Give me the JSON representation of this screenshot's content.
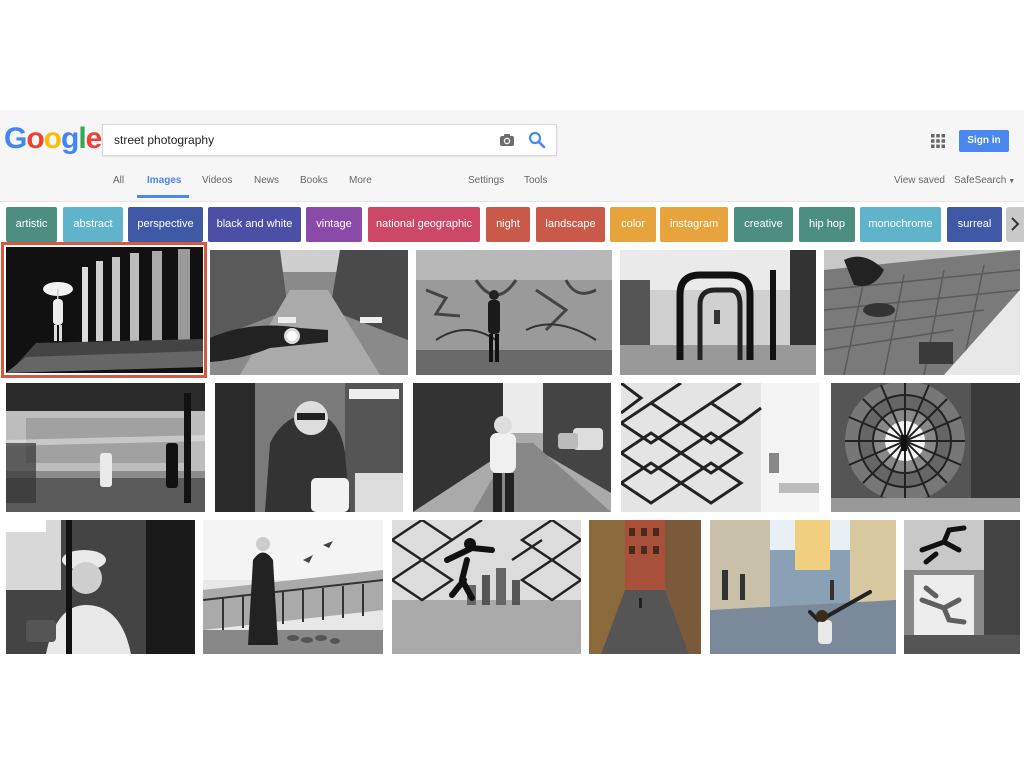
{
  "search": {
    "query": "street photography"
  },
  "logo": {
    "letters": [
      "G",
      "o",
      "o",
      "g",
      "l",
      "e"
    ],
    "colors": [
      "#4285f4",
      "#ea4335",
      "#fbbc05",
      "#4285f4",
      "#34a853",
      "#ea4335"
    ]
  },
  "header": {
    "sign_in_label": "Sign in"
  },
  "nav": {
    "all": "All",
    "images": "Images",
    "videos": "Videos",
    "news": "News",
    "books": "Books",
    "more": "More",
    "settings": "Settings",
    "tools": "Tools",
    "view_saved": "View saved",
    "safesearch": "SafeSearch"
  },
  "chips": [
    {
      "label": "artistic",
      "color": "#4c8e80"
    },
    {
      "label": "abstract",
      "color": "#5fb4cc"
    },
    {
      "label": "perspective",
      "color": "#3f59a6"
    },
    {
      "label": "black and white",
      "color": "#4b4fa6"
    },
    {
      "label": "vintage",
      "color": "#8a4aa8"
    },
    {
      "label": "national geographic",
      "color": "#cc4866"
    },
    {
      "label": "night",
      "color": "#c95a4a"
    },
    {
      "label": "landscape",
      "color": "#c95a4a"
    },
    {
      "label": "color",
      "color": "#e7a33c"
    },
    {
      "label": "instagram",
      "color": "#e7a33c"
    },
    {
      "label": "creative",
      "color": "#4c8e80"
    },
    {
      "label": "hip hop",
      "color": "#4c8e80"
    },
    {
      "label": "monochrome",
      "color": "#5fb4cc"
    },
    {
      "label": "surreal",
      "color": "#3f59a6"
    }
  ],
  "colors": {
    "accent": "#4a87ee",
    "selection": "#d8583f"
  }
}
